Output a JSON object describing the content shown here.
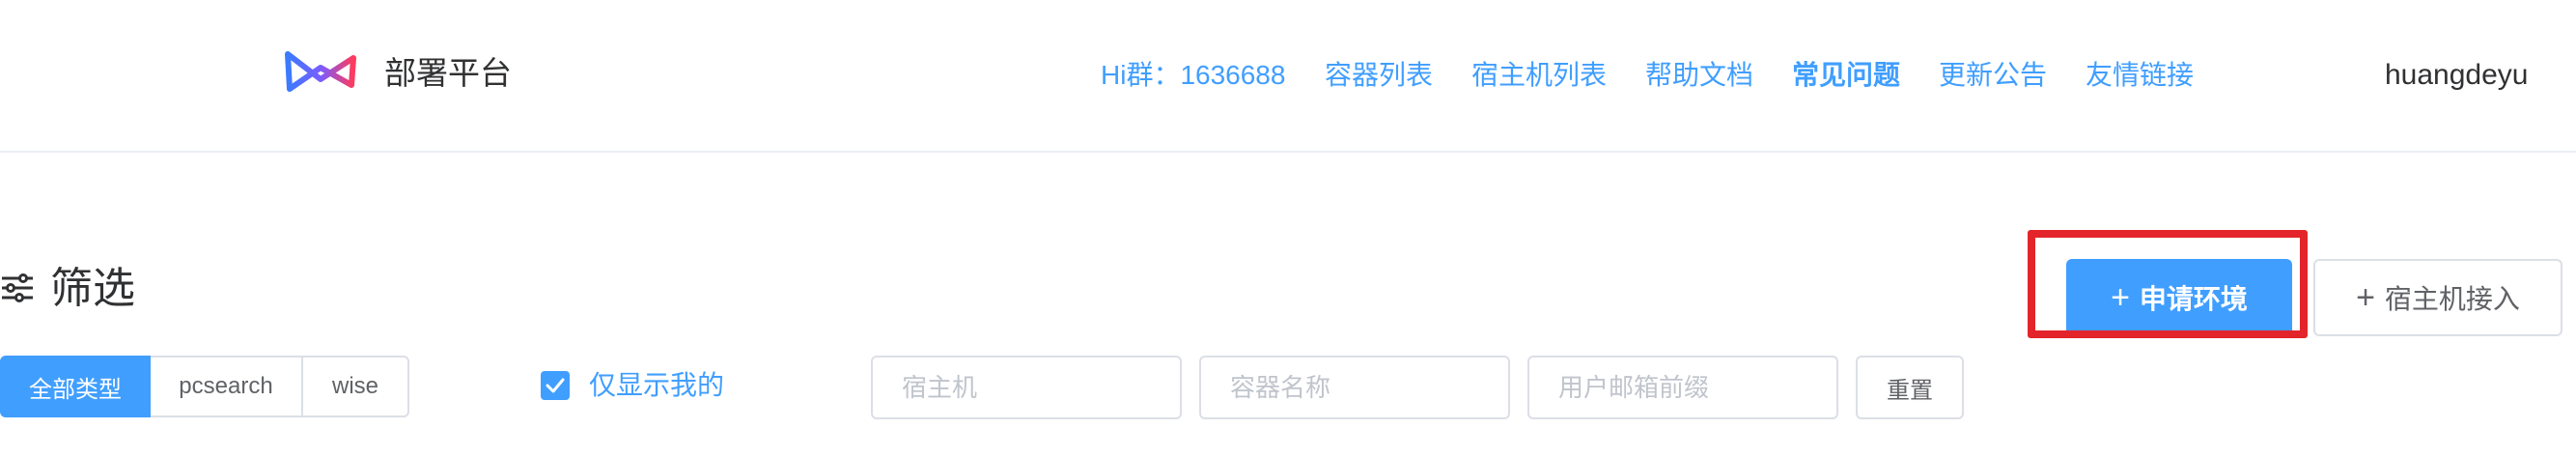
{
  "header": {
    "app_title": "部署平台",
    "nav": {
      "hi_group": "Hi群：1636688",
      "container_list": "容器列表",
      "host_list": "宿主机列表",
      "help_docs": "帮助文档",
      "faq": "常见问题",
      "updates": "更新公告",
      "friend_links": "友情链接"
    },
    "username": "huangdeyu"
  },
  "filter": {
    "title": "筛选",
    "types": [
      "全部类型",
      "pcsearch",
      "wise"
    ],
    "selected_type": "全部类型",
    "only_mine_label": "仅显示我的",
    "only_mine_checked": true,
    "host_placeholder": "宿主机",
    "container_name_placeholder": "容器名称",
    "email_prefix_placeholder": "用户邮箱前缀",
    "reset_label": "重置"
  },
  "actions": {
    "apply_env_label": "申请环境",
    "host_access_label": "宿主机接入"
  },
  "colors": {
    "primary": "#409eff",
    "highlight": "#e3242b",
    "text": "#303133",
    "border": "#dcdfe6"
  },
  "icons": {
    "logo": "bowtie-logo-icon",
    "filter": "sliders-icon",
    "plus": "plus-icon",
    "check": "check-icon"
  }
}
